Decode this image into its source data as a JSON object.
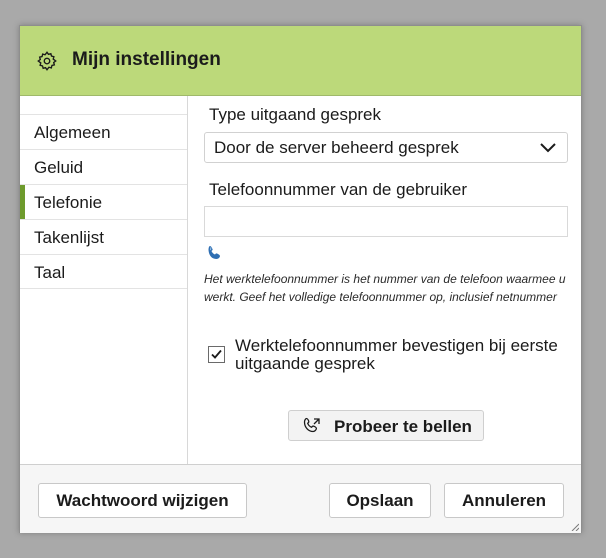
{
  "dialog": {
    "title": "Mijn instellingen",
    "header_color": "#bcd97a",
    "icon": "gear-icon"
  },
  "sidebar": {
    "active_accent": "#6e9b2d",
    "items": [
      {
        "label": "Algemeen"
      },
      {
        "label": "Geluid"
      },
      {
        "label": "Telefonie",
        "active": true
      },
      {
        "label": "Takenlijst"
      },
      {
        "label": "Taal"
      }
    ]
  },
  "telefonie": {
    "call_type_label": "Type uitgaand gesprek",
    "call_type_value": "Door de server beheerd gesprek",
    "phone_label": "Telefoonnummer van de gebruiker",
    "phone_value": "",
    "phone_icon": "phone-handset-icon",
    "help_text": "Het werktelefoonnummer is het nummer van de telefoon waarmee u werkt. Geef het volledige telefoonnummer op, inclusief netnummer",
    "confirm_checked": true,
    "confirm_label": "Werktelefoonnummer bevestigen bij eerste uitgaande gesprek",
    "try_call_label": "Probeer te bellen",
    "try_call_icon": "phone-call-icon"
  },
  "footer": {
    "change_password_label": "Wachtwoord wijzigen",
    "save_label": "Opslaan",
    "cancel_label": "Annuleren"
  }
}
